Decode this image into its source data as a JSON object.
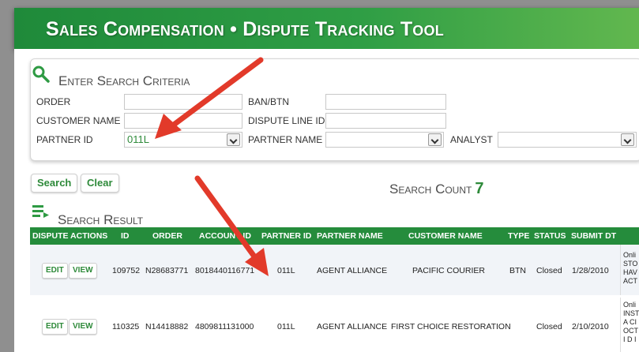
{
  "header": {
    "title": "Sales Compensation • Dispute Tracking Tool"
  },
  "criteria": {
    "title": "Enter Search Criteria",
    "order_label": "ORDER",
    "ban_label": "BAN/BTN",
    "customer_label": "CUSTOMER NAME",
    "dispute_line_label": "DISPUTE LINE ID",
    "partner_id_label": "PARTNER ID",
    "partner_id_value": "011L",
    "partner_name_label": "PARTNER NAME",
    "analyst_label": "ANALYST"
  },
  "buttons": {
    "search": "Search",
    "clear": "Clear"
  },
  "search_count": {
    "label": "Search Count",
    "value": "7"
  },
  "results": {
    "title": "Search Result",
    "columns": [
      "DISPUTE ACTIONS",
      "ID",
      "ORDER",
      "ACCOUNT ID",
      "PARTNER ID",
      "PARTNER NAME",
      "CUSTOMER NAME",
      "TYPE",
      "STATUS",
      "SUBMIT DT"
    ],
    "rows": [
      {
        "edit": "EDIT",
        "view": "VIEW",
        "id": "109752",
        "order": "N28683771",
        "account": "8018440116771",
        "partner_id": "011L",
        "partner_name": "AGENT ALLIANCE",
        "customer": "PACIFIC COURIER",
        "type": "BTN",
        "status": "Closed",
        "submit": "1/28/2010",
        "note": [
          "Onli",
          "STO",
          "HAV",
          "ACT"
        ]
      },
      {
        "edit": "EDIT",
        "view": "VIEW",
        "id": "110325",
        "order": "N14418882",
        "account": "4809811131000",
        "partner_id": "011L",
        "partner_name": "AGENT ALLIANCE",
        "customer": "FIRST CHOICE RESTORATION",
        "type": "",
        "status": "Closed",
        "submit": "2/10/2010",
        "note": [
          "Onli",
          "INST",
          "A CI",
          "OCT",
          "I D I"
        ]
      }
    ]
  },
  "colors": {
    "brand_green": "#258c3c",
    "arrow_red": "#e23a2a"
  }
}
